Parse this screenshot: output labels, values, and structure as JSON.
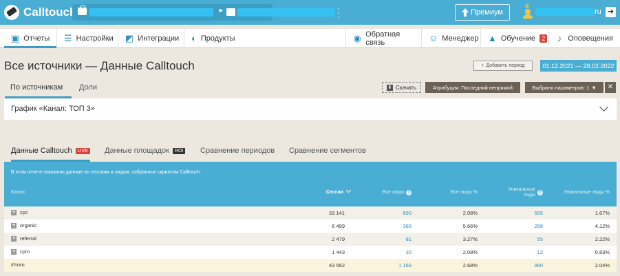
{
  "app": {
    "name": "Calltouch"
  },
  "topbar": {
    "premium_label": "Премиум",
    "user_email_suffix": "ru",
    "logout_icon": "logout-icon"
  },
  "nav": {
    "reports": "Отчеты",
    "settings": "Настройки",
    "integrations": "Интеграции",
    "products": "Продукты",
    "feedback": "Обратная связь",
    "manager": "Менеджер",
    "training": "Обучение",
    "training_badge": "2",
    "notifications": "Оповещения"
  },
  "page": {
    "title": "Все источники — Данные Calltouch",
    "add_period": "Добавить период",
    "date_range": "01.12.2021  —  28.02.2022"
  },
  "view_tabs": {
    "by_sources": "По источникам",
    "shares": "Доли"
  },
  "toolbar": {
    "download": "Скачать",
    "attribution": "Атрибуция: Последний непрямой",
    "params": "Выбрано параметров: 1"
  },
  "chart_panel": {
    "title": "График «Канал: ТОП 3»"
  },
  "data_tabs": {
    "calltouch": "Данные Calltouch",
    "calltouch_tag": "LIVE",
    "platforms": "Данные площадок",
    "platforms_tag": "ROI",
    "compare_periods": "Сравнение периодов",
    "compare_segments": "Сравнение сегментов"
  },
  "report": {
    "note": "В этом отчете показаны данные по сессиям и лидам, собранные скриптом Calltouch.",
    "columns": {
      "channel": "Канал",
      "sessions": "Сессии",
      "all_leads": "Все лиды",
      "all_leads_pct": "Все лиды %",
      "unique_leads_1": "Уникальные",
      "unique_leads_2": "лиды",
      "unique_leads_pct": "Уникальные лиды %"
    },
    "rows": [
      {
        "channel": "cpc",
        "sessions": "33 141",
        "leads": "690",
        "leads_pct": "2.08%",
        "uniq": "555",
        "uniq_pct": "1.67%"
      },
      {
        "channel": "organic",
        "sessions": "6 499",
        "leads": "368",
        "leads_pct": "5.66%",
        "uniq": "268",
        "uniq_pct": "4.12%"
      },
      {
        "channel": "referral",
        "sessions": "2 479",
        "leads": "81",
        "leads_pct": "3.27%",
        "uniq": "55",
        "uniq_pct": "2.22%"
      },
      {
        "channel": "cpm",
        "sessions": "1 443",
        "leads": "30",
        "leads_pct": "2.08%",
        "uniq": "12",
        "uniq_pct": "0.83%"
      }
    ],
    "total": {
      "label": "Итого",
      "sessions": "43 562",
      "leads": "1 169",
      "leads_pct": "2.68%",
      "uniq": "890",
      "uniq_pct": "2.04%"
    }
  },
  "colors": {
    "accent": "#4aaed4",
    "live": "#d9443a",
    "brown_button": "#6b6155"
  }
}
